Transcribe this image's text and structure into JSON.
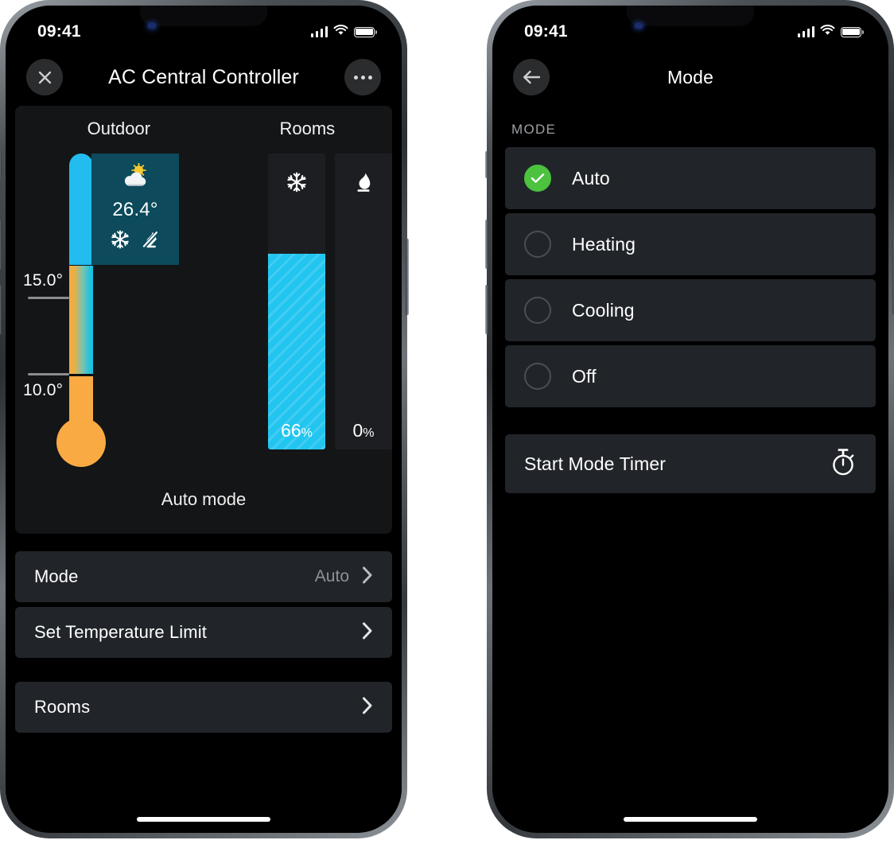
{
  "status_bar": {
    "time": "09:41",
    "signal_icon": "cellular-signal-icon",
    "wifi_icon": "wifi-icon",
    "battery_icon": "battery-full-icon"
  },
  "left_phone": {
    "nav": {
      "close_icon": "close-icon",
      "title": "AC Central Controller",
      "more_icon": "more-options-icon"
    },
    "card": {
      "outdoor_header": "Outdoor",
      "rooms_header": "Rooms",
      "footer_label": "Auto mode",
      "thermometer": {
        "upper_tick_label": "15.0°",
        "lower_tick_label": "10.0°",
        "cold_color": "#22bdee",
        "warm_color": "#f9aa42"
      },
      "weather_badge": {
        "weather_icon": "sun-behind-cloud-icon",
        "temperature": "26.4°",
        "cooling_icon": "snowflake-icon",
        "heating_off_icon": "flame-slashed-icon",
        "background_color": "#0c4a5c"
      },
      "room_bars": [
        {
          "icon": "snowflake-icon",
          "value_number": "66",
          "value_unit": "%",
          "percent": 66,
          "fill_color": "#22c5ef",
          "name": "cooling"
        },
        {
          "icon": "flame-icon",
          "value_number": "0",
          "value_unit": "%",
          "percent": 0,
          "fill_color": "#22c5ef",
          "name": "heating"
        }
      ]
    },
    "rows": [
      {
        "label": "Mode",
        "value": "Auto",
        "chevron": "chevron-right-icon"
      },
      {
        "label": "Set Temperature Limit",
        "value": "",
        "chevron": "chevron-right-icon"
      },
      {
        "label": "Rooms",
        "value": "",
        "chevron": "chevron-right-icon"
      }
    ]
  },
  "right_phone": {
    "nav": {
      "back_icon": "back-arrow-icon",
      "title": "Mode"
    },
    "section_label": "MODE",
    "options": [
      {
        "label": "Auto",
        "selected": true,
        "icon": "check-circle-icon"
      },
      {
        "label": "Heating",
        "selected": false,
        "icon": "radio-empty-icon"
      },
      {
        "label": "Cooling",
        "selected": false,
        "icon": "radio-empty-icon"
      },
      {
        "label": "Off",
        "selected": false,
        "icon": "radio-empty-icon"
      }
    ],
    "timer": {
      "label": "Start Mode Timer",
      "icon": "stopwatch-icon"
    },
    "accent_color": "#4cc23f"
  },
  "chart_data": {
    "type": "bar",
    "title": "Rooms",
    "categories": [
      "Cooling",
      "Heating"
    ],
    "values": [
      66,
      0
    ],
    "ylabel": "%",
    "ylim": [
      0,
      100
    ],
    "annotations": {
      "outdoor_temperature": 26.4,
      "thermometer_upper_limit": 15.0,
      "thermometer_lower_limit": 10.0
    }
  }
}
